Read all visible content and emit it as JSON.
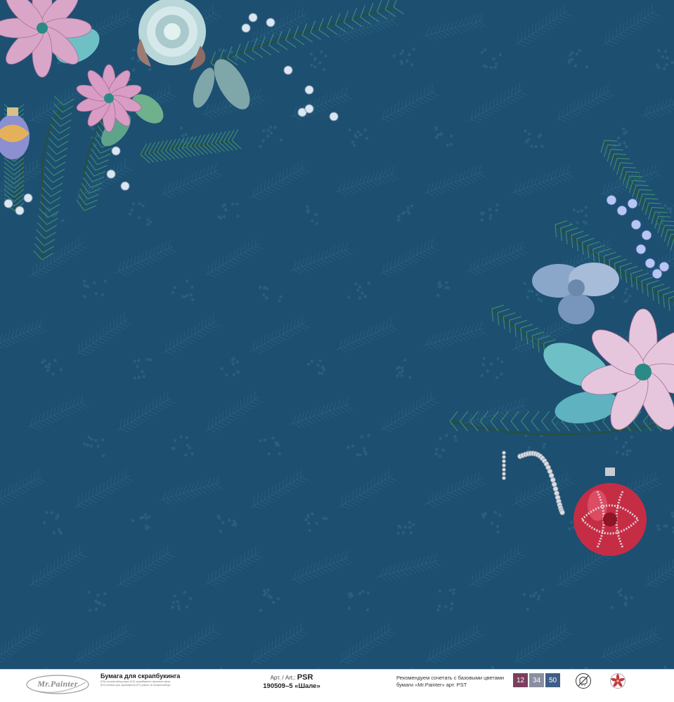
{
  "colors": {
    "background": "#1d4f71",
    "pattern": "#2c6381",
    "needle": "#1f4f4a",
    "poinsettia_pink": "#d99cc4",
    "ornament_red": "#c52d45"
  },
  "footer": {
    "logo_text": "Mr.Painter",
    "product_title": "Бумага для скрапбукинга",
    "product_lines": [
      "(EN) scrapbooking paper (KZ) скрапбукинге арналған қағаз",
      "(BY) папера для скрапбукінгу (PL) papier do scrapbookingu"
    ],
    "art_label": "Арт. / Art.:",
    "art_series": "PSR",
    "art_code": "190509–5 «Шале»",
    "recommend": "Рекомендуем сочетать с базовыми цветами бумаги «Mr.Painter» арт. PST",
    "swatches": [
      {
        "label": "12",
        "color": "#7b3f5e"
      },
      {
        "label": "34",
        "color": "#8a8ea0"
      },
      {
        "label": "50",
        "color": "#3f5e86"
      }
    ],
    "age_icon_label": "0-3",
    "flower_icon": "poinsettia-icon"
  }
}
